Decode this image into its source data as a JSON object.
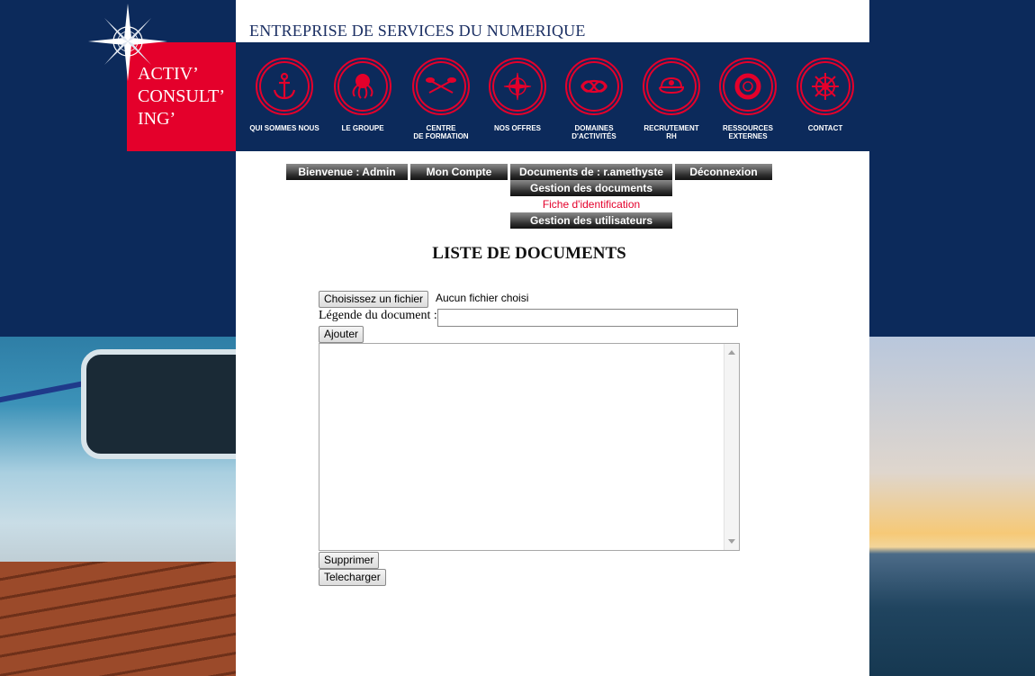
{
  "brand": {
    "logo_lines": [
      "ACTIV’",
      "CONSULT’",
      "ING’"
    ],
    "tagline": "ENTREPRISE DE SERVICES DU NUMERIQUE",
    "logo_color": "#e4002b",
    "navy": "#0c2a5b"
  },
  "nav": [
    {
      "label": "QUI SOMMES NOUS",
      "icon": "anchor-icon"
    },
    {
      "label": "LE GROUPE",
      "icon": "octopus-icon"
    },
    {
      "label": "CENTRE\nDE FORMATION",
      "icon": "oars-icon"
    },
    {
      "label": "NOS OFFRES",
      "icon": "compass-rose-icon"
    },
    {
      "label": "DOMAINES\nD'ACTIVITÉS",
      "icon": "knot-icon"
    },
    {
      "label": "RECRUTEMENT\nRH",
      "icon": "captain-hat-icon"
    },
    {
      "label": "RESSOURCES\nEXTERNES",
      "icon": "lifebuoy-icon"
    },
    {
      "label": "CONTACT",
      "icon": "ship-wheel-icon"
    }
  ],
  "menu": {
    "welcome": "Bienvenue : Admin",
    "account": "Mon Compte",
    "documents": "Documents de : r.amethyste",
    "logout": "Déconnexion",
    "manage_documents": "Gestion des documents",
    "id_sheet": "Fiche d'identification",
    "manage_users": "Gestion des utilisateurs"
  },
  "page": {
    "title": "LISTE DE DOCUMENTS"
  },
  "form": {
    "choose_file": "Choisissez un fichier",
    "file_status": "Aucun fichier choisi",
    "legend_label": "Légende du document :",
    "legend_value": "",
    "add": "Ajouter",
    "delete": "Supprimer",
    "download": "Telecharger",
    "documents": []
  }
}
